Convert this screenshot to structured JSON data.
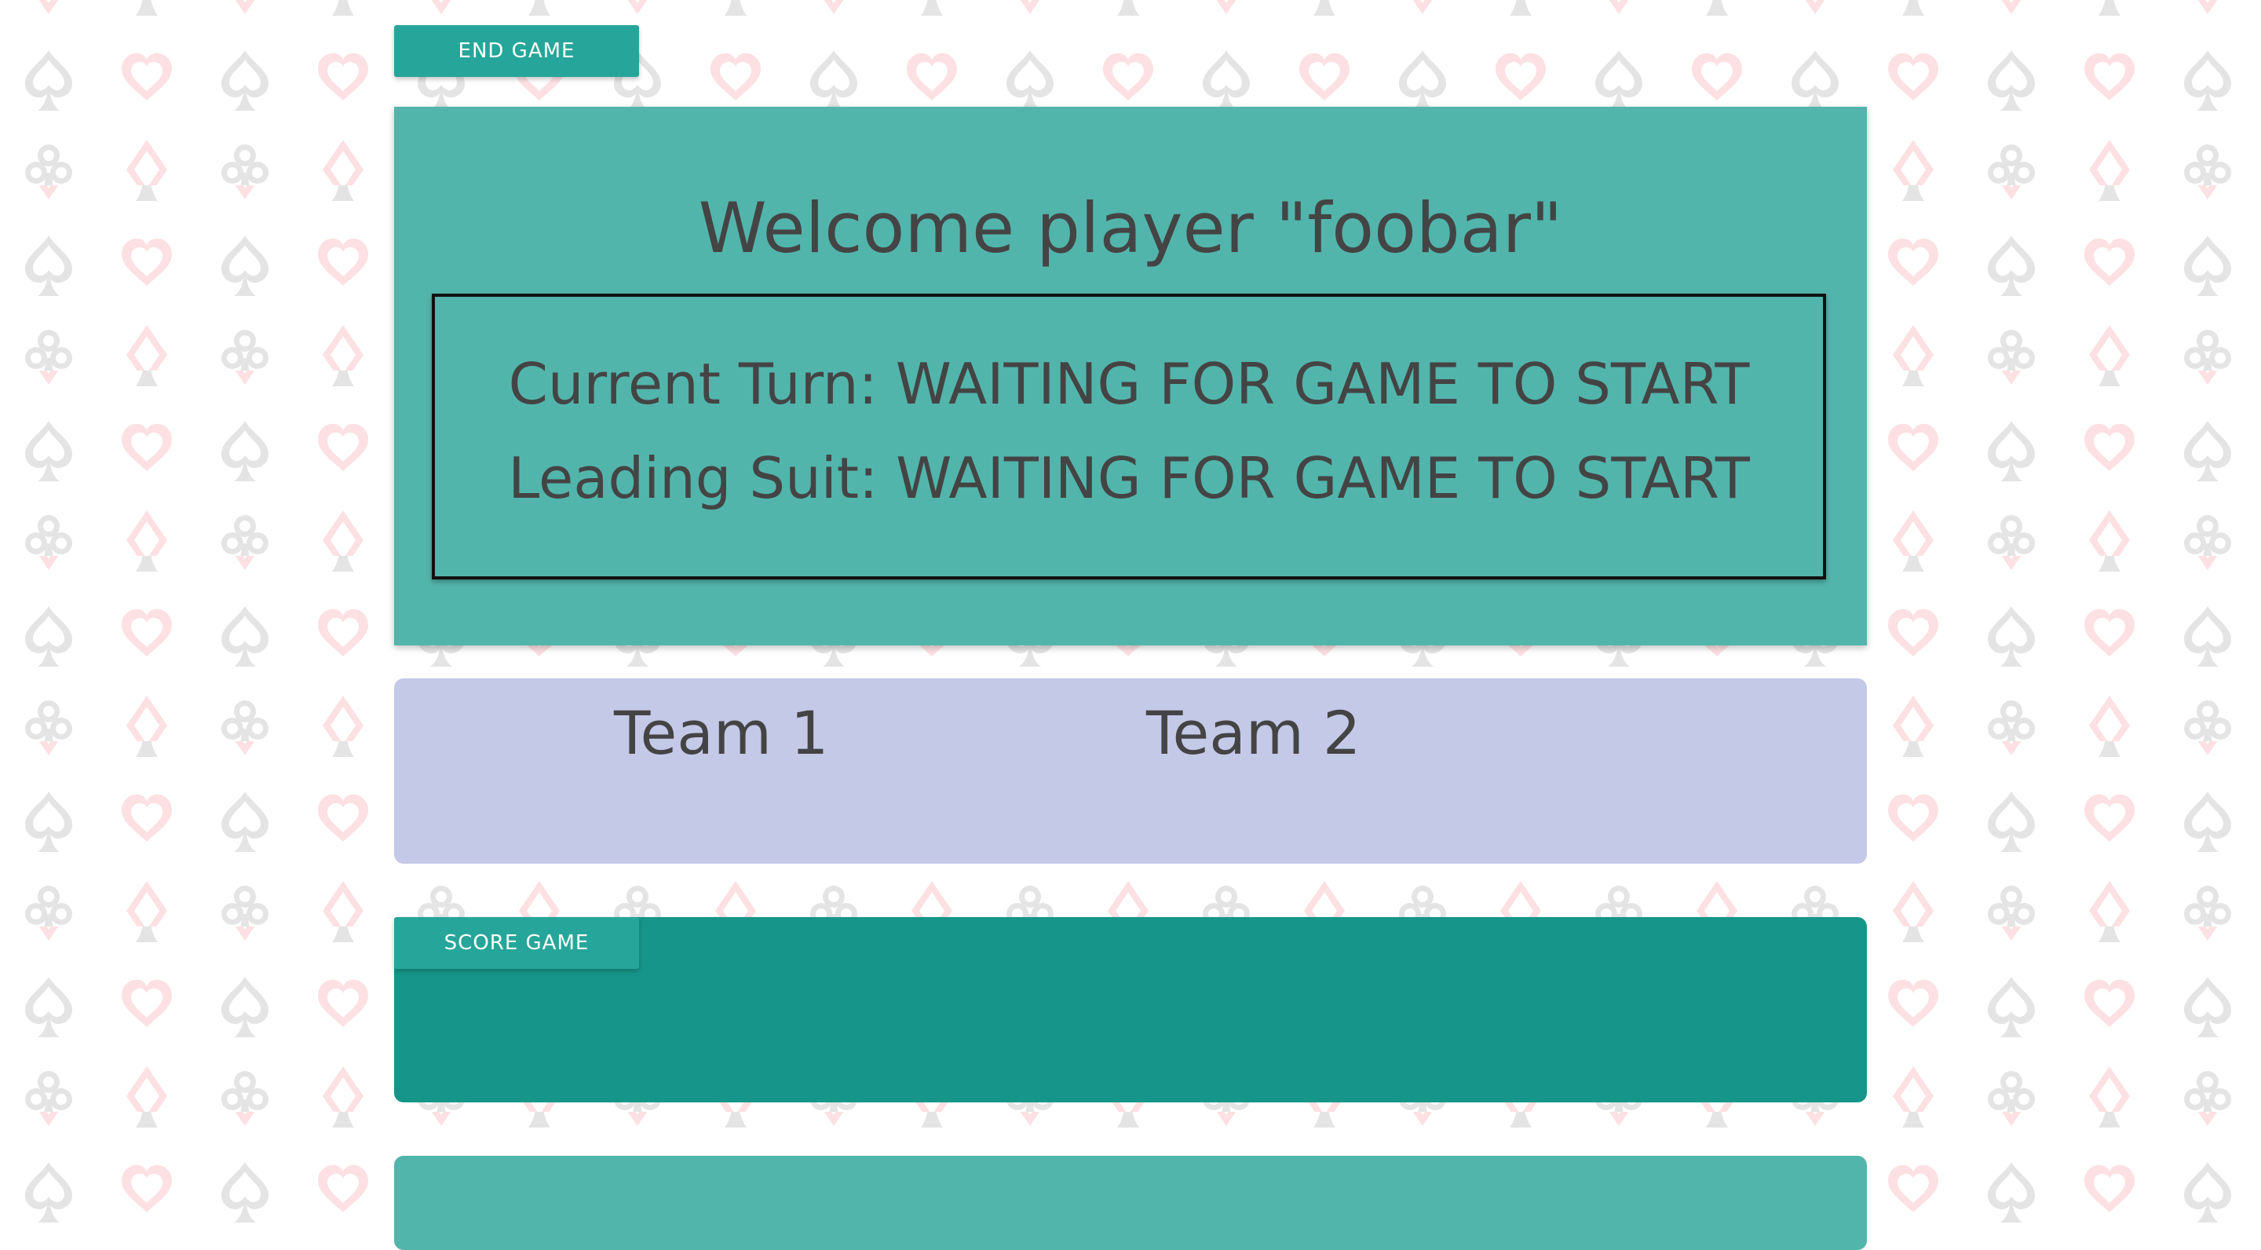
{
  "toolbar": {
    "end_game_label": "END GAME"
  },
  "welcome": {
    "title": "Welcome player \"foobar\"",
    "current_turn": "Current Turn: WAITING FOR GAME TO START",
    "leading_suit": "Leading Suit: WAITING FOR GAME TO START"
  },
  "teams": {
    "team1": "Team 1",
    "team2": "Team 2"
  },
  "score": {
    "score_game_label": "SCORE GAME"
  },
  "theme": {
    "accent": "#26a69a",
    "card_teal": "#52b5ac",
    "score_teal": "#16968a",
    "teams_lavender": "#c5c9e8",
    "pattern_grey": "#e6e6e6",
    "pattern_pink": "#fde2e4",
    "text": "#444444"
  }
}
